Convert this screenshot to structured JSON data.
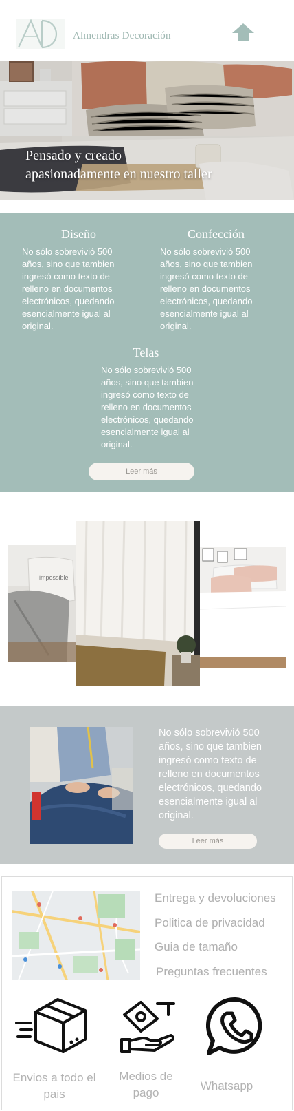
{
  "header": {
    "logo_text": "AD",
    "brand_name": "Almendras Decoración",
    "home_icon": "home-arrow-icon"
  },
  "hero": {
    "line1": "Pensado y creado",
    "line2": "apasionadamente en nuestro taller",
    "image": "bedroom-photo"
  },
  "features": {
    "design_title": "Diseño",
    "design_body": "No sólo sobrevivió 500 años, sino que tambien ingresó como texto de relleno en documentos electrónicos, quedando esencialmente igual al original.",
    "making_title": "Confección",
    "making_body": "No sólo sobrevivió 500 años, sino que tambien ingresó como texto de relleno en documentos electrónicos, quedando esencialmente igual al original.",
    "fabrics_title": "Telas",
    "fabrics_body": "No sólo sobrevivió 500 años, sino que tambien ingresó como texto de relleno en documentos electrónicos, quedando esencialmente igual al original.",
    "button": "Leer más"
  },
  "workshop": {
    "body": "No sólo sobrevivió 500 años, sino que tambien ingresó como texto de relleno en documentos electrónicos, quedando esencialmente igual al original.",
    "button": "Leer más"
  },
  "footer": {
    "links": [
      "Entrega y devoluciones",
      "Politica de privacidad",
      "Guia de tamaño",
      "Preguntas frecuentes"
    ],
    "shipping_label": "Envios a todo el pais",
    "payment_label": "Medios de pago",
    "whatsapp_label": "Whatsapp"
  },
  "colors": {
    "teal": "#a3bdb8",
    "gray": "#c4c9c9",
    "brand": "#9bb5af"
  }
}
